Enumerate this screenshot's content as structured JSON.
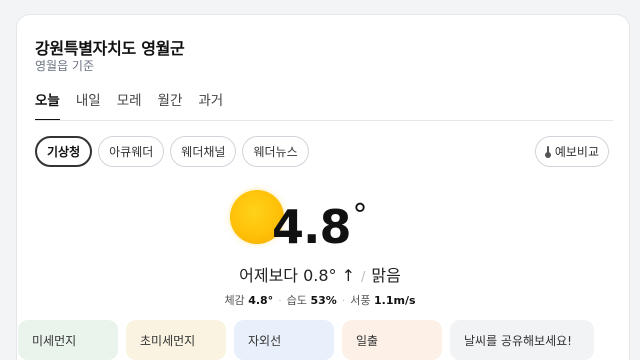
{
  "header": {
    "location": "강원특별자치도 영월군",
    "basis": "영월읍 기준"
  },
  "tabs": [
    {
      "label": "오늘",
      "active": true
    },
    {
      "label": "내일",
      "active": false
    },
    {
      "label": "모레",
      "active": false
    },
    {
      "label": "월간",
      "active": false
    },
    {
      "label": "과거",
      "active": false
    }
  ],
  "sources": [
    {
      "label": "기상청",
      "active": true
    },
    {
      "label": "아큐웨더",
      "active": false
    },
    {
      "label": "웨더채널",
      "active": false
    },
    {
      "label": "웨더뉴스",
      "active": false
    }
  ],
  "compare_label": "예보비교",
  "current": {
    "temperature": "4.8",
    "unit": "°",
    "weather_icon": "sun-icon",
    "vs_yesterday": "어제보다 0.8° ↑",
    "separator": "/",
    "condition": "맑음"
  },
  "details": {
    "feels_label": "체감",
    "feels_value": "4.8°",
    "humidity_label": "습도",
    "humidity_value": "53%",
    "wind_label": "서풍",
    "wind_value": "1.1m/s"
  },
  "info_cards": [
    {
      "label": "미세먼지"
    },
    {
      "label": "초미세먼지"
    },
    {
      "label": "자외선"
    },
    {
      "label": "일출"
    }
  ],
  "share_label": "날씨를 공유해보세요!",
  "colors": {
    "accent": "#111111",
    "sun": "#ffc107"
  }
}
